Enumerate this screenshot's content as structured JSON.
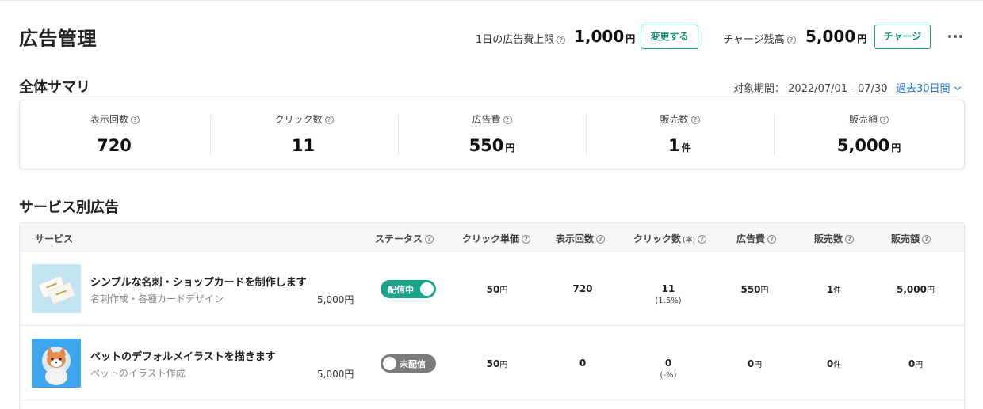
{
  "header": {
    "title": "広告管理",
    "daily_limit_label": "1日の広告費上限",
    "daily_limit_value": "1,000",
    "currency": "円",
    "change_button": "変更する",
    "charge_balance_label": "チャージ残高",
    "charge_balance_value": "5,000",
    "charge_button": "チャージ",
    "more_icon": "more-horizontal-icon"
  },
  "summary": {
    "title": "全体サマリ",
    "period_label": "対象期間：",
    "period_value": "2022/07/01 - 07/30",
    "period_select": "過去30日間",
    "metrics": [
      {
        "label": "表示回数",
        "value": "720",
        "unit": ""
      },
      {
        "label": "クリック数",
        "value": "11",
        "unit": ""
      },
      {
        "label": "広告費",
        "value": "550",
        "unit": "円"
      },
      {
        "label": "販売数",
        "value": "1",
        "unit": "件"
      },
      {
        "label": "販売額",
        "value": "5,000",
        "unit": "円"
      }
    ]
  },
  "services": {
    "title": "サービス別広告",
    "columns": {
      "service": "サービス",
      "status": "ステータス",
      "cpc": "クリック単価",
      "impressions": "表示回数",
      "clicks": "クリック数",
      "clicks_rate": "(率)",
      "cost": "広告費",
      "sales_count": "販売数",
      "sales_amount": "販売額"
    },
    "rows": [
      {
        "name": "シンプルな名刺・ショップカードを制作します",
        "category": "名刺作成・各種カードデザイン",
        "price": "5,000円",
        "status": "配信中",
        "status_on": true,
        "cpc": "50",
        "cpc_unit": "円",
        "impressions": "720",
        "clicks": "11",
        "click_rate": "(1.5%)",
        "cost": "550",
        "cost_unit": "円",
        "sales_count": "1",
        "sales_count_unit": "件",
        "sales_amount": "5,000",
        "sales_amount_unit": "円"
      },
      {
        "name": "ペットのデフォルメイラストを描きます",
        "category": "ペットのイラスト作成",
        "price": "5,000円",
        "status": "未配信",
        "status_on": false,
        "cpc": "50",
        "cpc_unit": "円",
        "impressions": "0",
        "clicks": "0",
        "click_rate": "(-%)",
        "cost": "0",
        "cost_unit": "円",
        "sales_count": "0",
        "sales_count_unit": "件",
        "sales_amount": "0",
        "sales_amount_unit": "円"
      }
    ]
  },
  "colors": {
    "accent": "#1aa38a",
    "link": "#1a73c8",
    "toggle_off": "#7b7b7b"
  }
}
